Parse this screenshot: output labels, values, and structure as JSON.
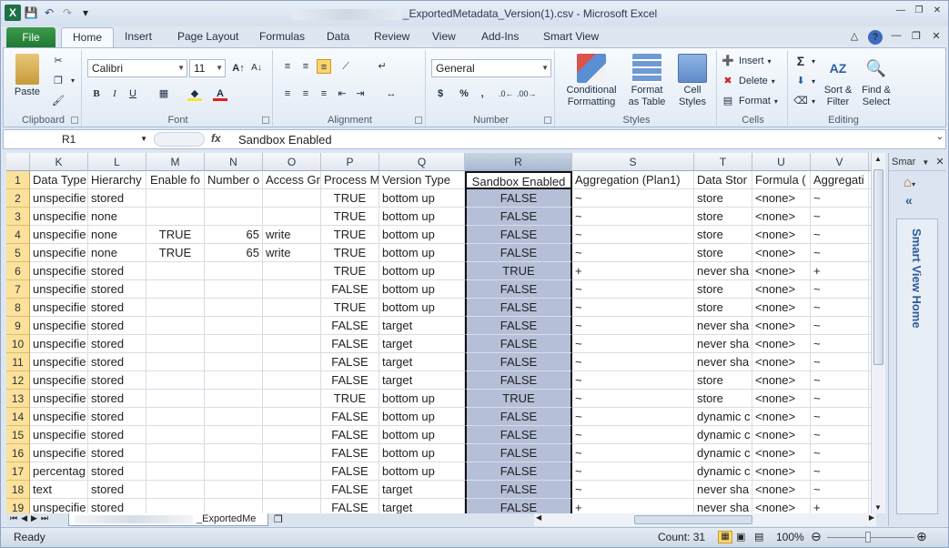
{
  "window": {
    "title_suffix": "_ExportedMetadata_Version(1).csv - Microsoft Excel"
  },
  "tabs": [
    "File",
    "Home",
    "Insert",
    "Page Layout",
    "Formulas",
    "Data",
    "Review",
    "View",
    "Add-Ins",
    "Smart View"
  ],
  "ribbon": {
    "clipboard": {
      "label": "Clipboard",
      "paste": "Paste"
    },
    "font": {
      "label": "Font",
      "name": "Calibri",
      "size": "11"
    },
    "alignment": {
      "label": "Alignment"
    },
    "number": {
      "label": "Number",
      "format": "General"
    },
    "styles": {
      "label": "Styles",
      "conditional": "Conditional",
      "formatting": "Formatting",
      "format": "Format",
      "as_table": "as Table",
      "cell": "Cell",
      "cell_styles": "Styles"
    },
    "cells": {
      "label": "Cells",
      "insert": "Insert",
      "delete": "Delete",
      "format": "Format"
    },
    "editing": {
      "label": "Editing",
      "sort": "Sort &",
      "filter": "Filter",
      "find": "Find &",
      "select": "Select"
    }
  },
  "formula_bar": {
    "name_box": "R1",
    "fx": "fx",
    "content": "Sandbox Enabled"
  },
  "columns": [
    "K",
    "L",
    "M",
    "N",
    "O",
    "P",
    "Q",
    "R",
    "S",
    "T",
    "U",
    "V",
    ""
  ],
  "header_row": [
    "Data Type",
    "Hierarchy",
    "Enable fo",
    "Number o",
    "Access Gr",
    "Process M",
    "Version Type",
    "Sandbox Enabled",
    "Aggregation (Plan1)",
    "Data Stor",
    "Formula (",
    "Aggregati",
    ""
  ],
  "rows": [
    {
      "n": "2",
      "c": [
        "unspecifie",
        "stored",
        "",
        "",
        "",
        "TRUE",
        "bottom up",
        "FALSE",
        "~",
        "store",
        "<none>",
        "~",
        "s"
      ]
    },
    {
      "n": "3",
      "c": [
        "unspecifie",
        "none",
        "",
        "",
        "",
        "TRUE",
        "bottom up",
        "FALSE",
        "~",
        "store",
        "<none>",
        "~",
        "s"
      ]
    },
    {
      "n": "4",
      "c": [
        "unspecifie",
        "none",
        "TRUE",
        "65",
        "write",
        "TRUE",
        "bottom up",
        "FALSE",
        "~",
        "store",
        "<none>",
        "~",
        "s"
      ]
    },
    {
      "n": "5",
      "c": [
        "unspecifie",
        "none",
        "TRUE",
        "65",
        "write",
        "TRUE",
        "bottom up",
        "FALSE",
        "~",
        "store",
        "<none>",
        "~",
        "s"
      ]
    },
    {
      "n": "6",
      "c": [
        "unspecifie",
        "stored",
        "",
        "",
        "",
        "TRUE",
        "bottom up",
        "TRUE",
        "+",
        "never sha",
        "<none>",
        "+",
        "n"
      ]
    },
    {
      "n": "7",
      "c": [
        "unspecifie",
        "stored",
        "",
        "",
        "",
        "FALSE",
        "bottom up",
        "FALSE",
        "~",
        "store",
        "<none>",
        "~",
        "s"
      ]
    },
    {
      "n": "8",
      "c": [
        "unspecifie",
        "stored",
        "",
        "",
        "",
        "TRUE",
        "bottom up",
        "FALSE",
        "~",
        "store",
        "<none>",
        "~",
        "s"
      ]
    },
    {
      "n": "9",
      "c": [
        "unspecifie",
        "stored",
        "",
        "",
        "",
        "FALSE",
        "target",
        "FALSE",
        "~",
        "never sha",
        "<none>",
        "~",
        "n"
      ]
    },
    {
      "n": "10",
      "c": [
        "unspecifie",
        "stored",
        "",
        "",
        "",
        "FALSE",
        "target",
        "FALSE",
        "~",
        "never sha",
        "<none>",
        "~",
        "n"
      ]
    },
    {
      "n": "11",
      "c": [
        "unspecifie",
        "stored",
        "",
        "",
        "",
        "FALSE",
        "target",
        "FALSE",
        "~",
        "never sha",
        "<none>",
        "~",
        "n"
      ]
    },
    {
      "n": "12",
      "c": [
        "unspecifie",
        "stored",
        "",
        "",
        "",
        "FALSE",
        "target",
        "FALSE",
        "~",
        "store",
        "<none>",
        "~",
        "s"
      ]
    },
    {
      "n": "13",
      "c": [
        "unspecifie",
        "stored",
        "",
        "",
        "",
        "TRUE",
        "bottom up",
        "TRUE",
        "~",
        "store",
        "<none>",
        "~",
        "s"
      ]
    },
    {
      "n": "14",
      "c": [
        "unspecifie",
        "stored",
        "",
        "",
        "",
        "FALSE",
        "bottom up",
        "FALSE",
        "~",
        "dynamic c",
        "<none>",
        "~",
        "d"
      ]
    },
    {
      "n": "15",
      "c": [
        "unspecifie",
        "stored",
        "",
        "",
        "",
        "FALSE",
        "bottom up",
        "FALSE",
        "~",
        "dynamic c",
        "<none>",
        "~",
        "d"
      ]
    },
    {
      "n": "16",
      "c": [
        "unspecifie",
        "stored",
        "",
        "",
        "",
        "FALSE",
        "bottom up",
        "FALSE",
        "~",
        "dynamic c",
        "<none>",
        "~",
        "d"
      ]
    },
    {
      "n": "17",
      "c": [
        "percentag",
        "stored",
        "",
        "",
        "",
        "FALSE",
        "bottom up",
        "FALSE",
        "~",
        "dynamic c",
        "<none>",
        "~",
        "d"
      ]
    },
    {
      "n": "18",
      "c": [
        "text",
        "stored",
        "",
        "",
        "",
        "FALSE",
        "target",
        "FALSE",
        "~",
        "never sha",
        "<none>",
        "~",
        "n"
      ]
    },
    {
      "n": "19",
      "c": [
        "unspecifie",
        "stored",
        "",
        "",
        "",
        "FALSE",
        "target",
        "FALSE",
        "+",
        "never sha",
        "<none>",
        "+",
        "n"
      ]
    }
  ],
  "sheet_tab": "_ExportedMe",
  "status": {
    "ready": "Ready",
    "count": "Count: 31",
    "zoom": "100%"
  },
  "side_pane": {
    "title": "Smar",
    "home": "Smart View Home"
  }
}
